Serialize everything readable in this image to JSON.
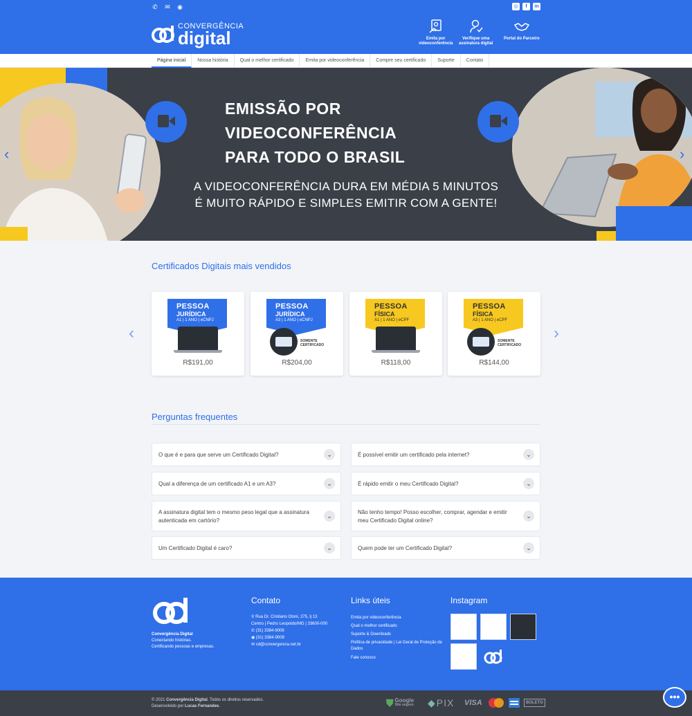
{
  "header": {
    "contact_icons": [
      "phone-icon",
      "mail-icon",
      "whatsapp-icon"
    ],
    "social_icons": [
      "instagram-icon",
      "facebook-icon",
      "linkedin-icon"
    ],
    "social_labels": [
      "◎",
      "f",
      "in"
    ],
    "logo_top": "CONVERGÊNCIA",
    "logo_big": "digital",
    "nav": [
      {
        "label_1": "Emita por",
        "label_2": "videoconferência",
        "icon": "video-certificate-icon"
      },
      {
        "label_1": "Verifique uma",
        "label_2": "assinatura digital",
        "icon": "verify-signature-icon"
      },
      {
        "label_1": "Portal do Parceiro",
        "label_2": "",
        "icon": "handshake-icon"
      }
    ],
    "accent": "#2f6fe8"
  },
  "menu": [
    "Página inicial",
    "Nossa história",
    "Qual o melhor certificado",
    "Emita por videoconferência",
    "Compre seu certificado",
    "Suporte",
    "Contato"
  ],
  "hero": {
    "title_1": "EMISSÃO POR",
    "title_2": "VIDEOCONFERÊNCIA",
    "title_3": "PARA TODO O BRASIL",
    "sub_1": "A VIDEOCONFERÊNCIA DURA EM MÉDIA 5 MINUTOS",
    "sub_2": "É MUITO RÁPIDO E SIMPLES EMITIR COM A GENTE!",
    "prev": "‹",
    "next": "›"
  },
  "products": {
    "title": "Certificados Digitais mais vendidos",
    "prev": "‹",
    "next": "›",
    "items": [
      {
        "type_1": "PESSOA",
        "type_2": "JURÍDICA",
        "detail": "A1 | 1 ANO | eCNPJ",
        "price": "R$191,00",
        "color": "#2f6fe8",
        "text_color": "#ffffff",
        "media": "laptop",
        "note_1": "",
        "note_2": ""
      },
      {
        "type_1": "PESSOA",
        "type_2": "JURÍDICA",
        "detail": "A3 | 1 ANO | eCNPJ",
        "price": "R$204,00",
        "color": "#2f6fe8",
        "text_color": "#ffffff",
        "media": "token",
        "note_1": "SOMENTE",
        "note_2": "CERTIFICADO"
      },
      {
        "type_1": "PESSOA",
        "type_2": "FÍSICA",
        "detail": "A1 | 1 ANO | eCPF",
        "price": "R$118,00",
        "color": "#f7c81f",
        "text_color": "#333333",
        "media": "laptop",
        "note_1": "",
        "note_2": ""
      },
      {
        "type_1": "PESSOA",
        "type_2": "FÍSICA",
        "detail": "A3 | 1 ANO | eCPF",
        "price": "R$144,00",
        "color": "#f7c81f",
        "text_color": "#333333",
        "media": "token",
        "note_1": "SOMENTE",
        "note_2": "CERTIFICADO"
      }
    ]
  },
  "faq": {
    "title": "Perguntas frequentes",
    "chevron": "⌄",
    "items": [
      "O que é e para que serve um Certificado Digital?",
      "É possível emitir um certificado pela internet?",
      "Qual a diferença de um certificado A1 e um A3?",
      "É rápido emitir o meu Certificado Digital?",
      "A assinatura digital tem o mesmo peso legal que a assinatura autenticada em cartório?",
      "Não tenho tempo! Posso escolher, comprar, agendar e emitir meu Certificado Digital online?",
      "Um Certificado Digital é caro?",
      "Quem pode ter um Certificado Digital?"
    ]
  },
  "footer": {
    "brand_name": "Convergência Digital",
    "brand_line_1": "Conectando histórias.",
    "brand_line_2": "Certificando pessoas e empresas.",
    "contact_title": "Contato",
    "address_1": "Rua Dr. Cristiano Otoni, 275, lj 13",
    "address_2": "Centro | Pedro Leopoldo/MG | 33600-000",
    "phone": "(31) 3384-9008",
    "whatsapp": "(31) 3384-9008",
    "email": "cd@convergencia.net.br",
    "links_title": "Links úteis",
    "links": [
      "Emita por videoconferência",
      "Qual o melhor certificado",
      "Suporte & Downloads",
      "Política de privacidade | Lei Geral de Proteção de Dados",
      "Fale conosco"
    ],
    "instagram_title": "Instagram"
  },
  "bottom": {
    "copy_pre": "© 2021 ",
    "copy_brand": "Convergência Digital",
    "copy_post": ". Todos os direitos reservados.",
    "dev_pre": "Desenvolvido por ",
    "dev_name": "Lucas Fernandes",
    "dev_post": ".",
    "google": "Google",
    "google_sub": "Site seguro",
    "pix": "PIX",
    "visa": "VISA",
    "boleto": "BOLETO"
  },
  "chat_glyph": "•••"
}
